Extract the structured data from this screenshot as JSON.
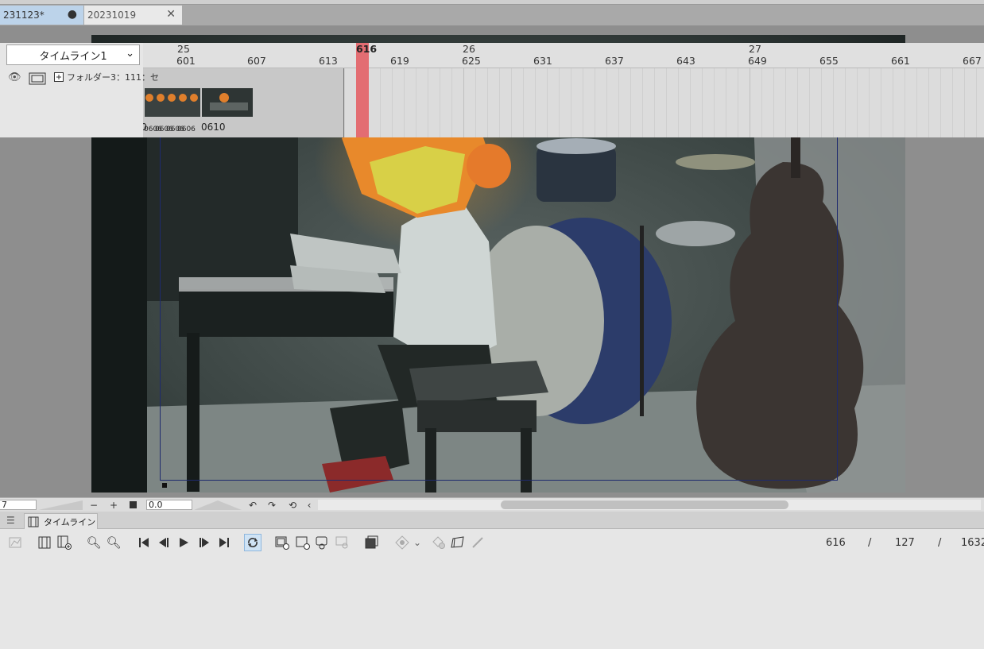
{
  "tabs": [
    {
      "label": "231123*",
      "marker": "●",
      "active": true
    },
    {
      "label": "20231019",
      "marker": "✕",
      "active": false
    }
  ],
  "navbar": {
    "zoom_value": "7",
    "zoom_minus": "−",
    "zoom_plus": "+",
    "rotation_value": "0.0"
  },
  "timeline": {
    "panel_tab_label": "タイムライン",
    "timeline_selector": "タイムライン1",
    "current_frame": "616",
    "separator": "/",
    "end_frame": "127",
    "total_frames": "1632",
    "playhead_label": "616",
    "ruler_seconds": [
      "25",
      "26",
      "27"
    ],
    "ruler_frames": [
      "601",
      "607",
      "613",
      "619",
      "625",
      "631",
      "637",
      "643",
      "649",
      "655",
      "661",
      "667"
    ],
    "track_label": "フォルダー3：111：セ",
    "thumb_labels": [
      "0500",
      "0501",
      "050",
      "0606",
      "0606",
      "0606",
      "0606",
      "0610"
    ]
  },
  "colors": {
    "active_tab": "#bcd3ea",
    "playhead": "#e36d72",
    "frame_guide": "#1e2a6e"
  },
  "icons": [
    "menu-icon",
    "timeline-icon",
    "new-timeline-icon",
    "edit-timeline-icon",
    "zoom-out-icon",
    "zoom-in-icon",
    "first-frame-icon",
    "prev-frame-icon",
    "play-icon",
    "next-frame-icon",
    "last-frame-icon",
    "loop-icon",
    "new-animation-folder-icon",
    "new-cel-icon",
    "specify-cel-icon",
    "delete-cel-icon",
    "onion-skin-icon",
    "enable-camerawork-icon",
    "chevron-down-icon",
    "keyframe-icon",
    "keyframe-interp-icon",
    "pen-icon",
    "eye-icon",
    "folder-icon",
    "expand-icon"
  ]
}
